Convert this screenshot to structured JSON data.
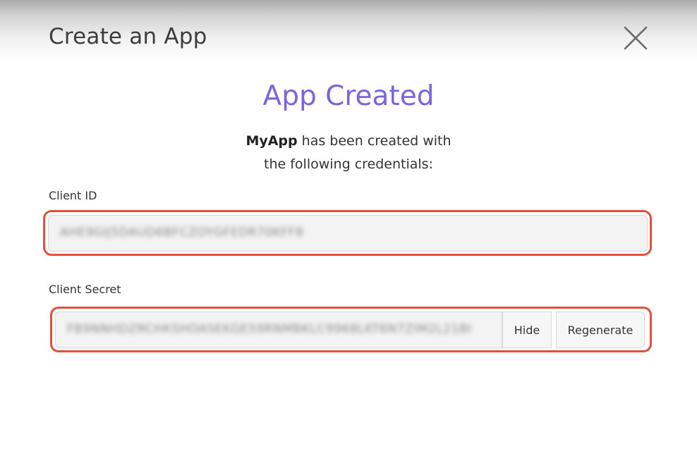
{
  "modal": {
    "title": "Create an App",
    "close_icon": "close-icon"
  },
  "success": {
    "heading": "App Created",
    "app_name": "MyApp",
    "desc_line1_rest": " has been created with",
    "desc_line2": "the following credentials:"
  },
  "client_id": {
    "label": "Client ID",
    "value": "AHE9GIJ5DAUD6BFCZOYGFEDR70KFF8"
  },
  "client_secret": {
    "label": "Client Secret",
    "value": "FB9NNHDZRCHKSHOASEKGE59RNMBKLC9968LKT6N7ZIM2L21BI",
    "hide_label": "Hide",
    "regenerate_label": "Regenerate"
  },
  "colors": {
    "accent": "#7c64dd",
    "highlight": "#e0503a"
  }
}
